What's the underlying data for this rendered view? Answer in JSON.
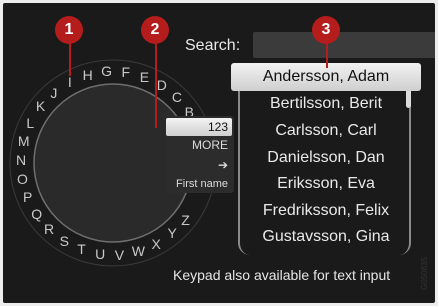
{
  "search": {
    "label": "Search:",
    "value": ""
  },
  "wheel": {
    "letters": [
      "A",
      "B",
      "C",
      "D",
      "E",
      "F",
      "G",
      "H",
      "I",
      "J",
      "K",
      "L",
      "M",
      "N",
      "O",
      "P",
      "Q",
      "R",
      "S",
      "T",
      "U",
      "V",
      "W",
      "X",
      "Y",
      "Z"
    ],
    "options": {
      "numbers": "123",
      "more": "MORE",
      "arrow": "➔",
      "first_name": "First name"
    }
  },
  "contacts": [
    "Andersson, Adam",
    "Bertilsson, Berit",
    "Carlsson, Carl",
    "Danielsson, Dan",
    "Eriksson, Eva",
    "Fredriksson, Felix",
    "Gustavsson, Gina"
  ],
  "status_text": "Keypad also available for text input",
  "callouts": [
    "1",
    "2",
    "3"
  ],
  "image_code": "G050835",
  "colors": {
    "callout": "#b51c1c",
    "screen_bg": "#1a1a1a",
    "text": "#e8e8e8"
  }
}
